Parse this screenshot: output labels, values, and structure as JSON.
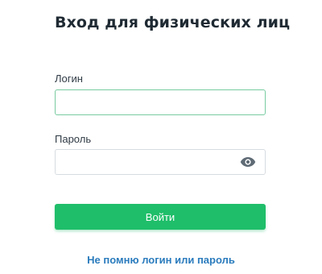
{
  "form": {
    "title": "Вход для физических лиц",
    "login_label": "Логин",
    "login_value": "",
    "login_placeholder": "",
    "password_label": "Пароль",
    "password_value": "",
    "password_placeholder": "",
    "show_password_icon": "eye-icon",
    "submit_label": "Войти",
    "forgot_link": "Не помню логин или пароль"
  },
  "colors": {
    "accent_green": "#1fbe6a",
    "link_blue": "#2a7bbd",
    "focus_border": "#79cba1",
    "title_text": "#1f2a33"
  }
}
